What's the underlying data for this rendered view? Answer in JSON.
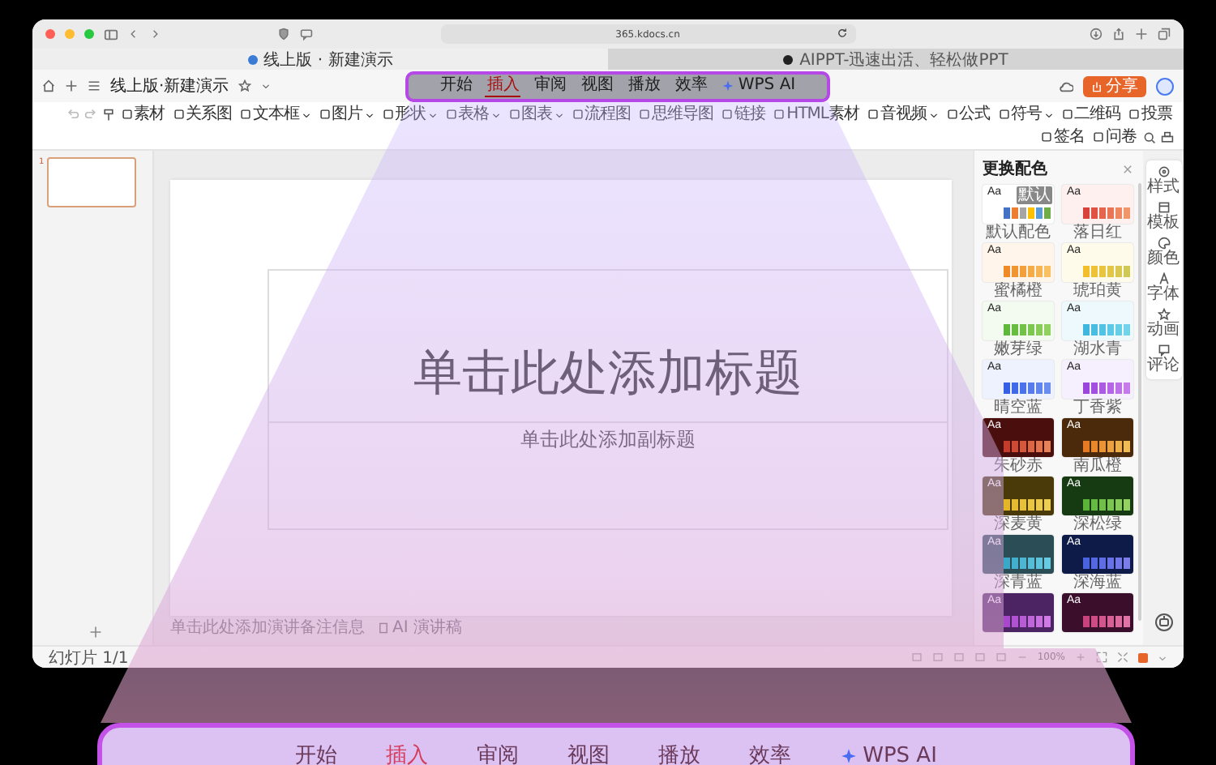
{
  "browser": {
    "url": "365.kdocs.cn",
    "tabs": [
      {
        "title": "线上版 · 新建演示",
        "selected": true
      },
      {
        "title": "AIPPT-迅速出活、轻松做PPT",
        "selected": false
      }
    ]
  },
  "app": {
    "doc_title": "线上版·新建演示",
    "tabs": [
      {
        "label": "开始",
        "selected": false
      },
      {
        "label": "插入",
        "selected": true
      },
      {
        "label": "审阅",
        "selected": false
      },
      {
        "label": "视图",
        "selected": false
      },
      {
        "label": "播放",
        "selected": false
      },
      {
        "label": "效率",
        "selected": false
      },
      {
        "label": "WPS AI",
        "selected": false
      }
    ],
    "share_label": "分享"
  },
  "toolbar": {
    "items": [
      {
        "label": "素材",
        "dropdown": false
      },
      {
        "label": "关系图",
        "dropdown": false
      },
      {
        "label": "文本框",
        "dropdown": true
      },
      {
        "label": "图片",
        "dropdown": true
      },
      {
        "label": "形状",
        "dropdown": true
      },
      {
        "label": "表格",
        "dropdown": true
      },
      {
        "label": "图表",
        "dropdown": true
      },
      {
        "label": "流程图",
        "dropdown": false
      },
      {
        "label": "思维导图",
        "dropdown": false
      },
      {
        "label": "链接",
        "dropdown": false
      },
      {
        "label": "HTML素材",
        "dropdown": false
      },
      {
        "label": "音视频",
        "dropdown": true
      },
      {
        "label": "公式",
        "dropdown": false
      },
      {
        "label": "符号",
        "dropdown": true
      },
      {
        "label": "二维码",
        "dropdown": false
      },
      {
        "label": "投票",
        "dropdown": false
      },
      {
        "label": "签名",
        "dropdown": false
      },
      {
        "label": "问卷",
        "dropdown": false
      }
    ]
  },
  "thumbnails": [
    {
      "number": "1",
      "selected": true
    }
  ],
  "slide": {
    "title": "单击此处添加标题",
    "subtitle": "单击此处添加副标题",
    "notes": "单击此处添加演讲备注信息",
    "ai_notes": "AI 演讲稿"
  },
  "theme_panel": {
    "title": "更换配色",
    "themes": [
      {
        "name": "默认配色",
        "sample": "Aa",
        "badge": "默认",
        "dark": false,
        "color": "#ffffff",
        "swatches": [
          {
            "color": "#4472c4"
          },
          {
            "color": "#ed7d31"
          },
          {
            "color": "#a5a5a5"
          },
          {
            "color": "#ffc000"
          },
          {
            "color": "#5b9bd5"
          },
          {
            "color": "#70ad47"
          }
        ]
      },
      {
        "name": "落日红",
        "sample": "Aa",
        "dark": false,
        "color": "#fdf0ee",
        "swatches": [
          {
            "color": "#d9423a"
          },
          {
            "color": "#e05243"
          },
          {
            "color": "#e5644c"
          },
          {
            "color": "#ea7555"
          },
          {
            "color": "#ee8660"
          },
          {
            "color": "#f1966a"
          }
        ]
      },
      {
        "name": "蜜橘橙",
        "sample": "Aa",
        "dark": false,
        "color": "#fff5ea",
        "swatches": [
          {
            "color": "#ef8a26"
          },
          {
            "color": "#f19530"
          },
          {
            "color": "#f3a03a"
          },
          {
            "color": "#f5ab46"
          },
          {
            "color": "#f6b552"
          },
          {
            "color": "#f8c060"
          }
        ]
      },
      {
        "name": "琥珀黄",
        "sample": "Aa",
        "dark": false,
        "color": "#fffbea",
        "swatches": [
          {
            "color": "#f2be2c"
          },
          {
            "color": "#eec236"
          },
          {
            "color": "#e8c43f"
          },
          {
            "color": "#e1c647"
          },
          {
            "color": "#d9c74e"
          },
          {
            "color": "#d0c854"
          }
        ]
      },
      {
        "name": "嫩芽绿",
        "sample": "Aa",
        "dark": false,
        "color": "#f3faef",
        "swatches": [
          {
            "color": "#5fb83a"
          },
          {
            "color": "#68bd40"
          },
          {
            "color": "#72c247"
          },
          {
            "color": "#7cc74f"
          },
          {
            "color": "#86cc57"
          },
          {
            "color": "#90d160"
          }
        ]
      },
      {
        "name": "湖水青",
        "sample": "Aa",
        "dark": false,
        "color": "#edf9fd",
        "swatches": [
          {
            "color": "#3fb6dd"
          },
          {
            "color": "#48bde0"
          },
          {
            "color": "#52c3e3"
          },
          {
            "color": "#5cc9e6"
          },
          {
            "color": "#66cfe8"
          },
          {
            "color": "#71d4eb"
          }
        ]
      },
      {
        "name": "晴空蓝",
        "sample": "Aa",
        "dark": false,
        "color": "#eef2fe",
        "swatches": [
          {
            "color": "#3560e6"
          },
          {
            "color": "#3f69e8"
          },
          {
            "color": "#4a72ea"
          },
          {
            "color": "#557bec"
          },
          {
            "color": "#6084ee"
          },
          {
            "color": "#6b8df0"
          }
        ]
      },
      {
        "name": "丁香紫",
        "sample": "Aa",
        "dark": false,
        "color": "#f6effd",
        "swatches": [
          {
            "color": "#9a45dc"
          },
          {
            "color": "#a34fdf"
          },
          {
            "color": "#ac5ae2"
          },
          {
            "color": "#b565e5"
          },
          {
            "color": "#be70e8"
          },
          {
            "color": "#c77beb"
          }
        ]
      },
      {
        "name": "朱砂赤",
        "sample": "Aa",
        "dark": true,
        "color": "#4a0f0c",
        "swatches": [
          {
            "color": "#c63c2c"
          },
          {
            "color": "#cd4a34"
          },
          {
            "color": "#d4583d"
          },
          {
            "color": "#da6646"
          },
          {
            "color": "#e0744f"
          },
          {
            "color": "#e68259"
          }
        ]
      },
      {
        "name": "南瓜橙",
        "sample": "Aa",
        "dark": true,
        "color": "#4b2a0b",
        "swatches": [
          {
            "color": "#e57a22"
          },
          {
            "color": "#e8872c"
          },
          {
            "color": "#ea9436"
          },
          {
            "color": "#eca140"
          },
          {
            "color": "#eeae4a"
          },
          {
            "color": "#f0bb55"
          }
        ]
      },
      {
        "name": "深麦黄",
        "sample": "Aa",
        "dark": true,
        "color": "#4a3a0a",
        "swatches": [
          {
            "color": "#e2b628"
          },
          {
            "color": "#e4bb31"
          },
          {
            "color": "#e6c03a"
          },
          {
            "color": "#e8c543"
          },
          {
            "color": "#eac94c"
          },
          {
            "color": "#ecce55"
          }
        ]
      },
      {
        "name": "深松绿",
        "sample": "Aa",
        "dark": true,
        "color": "#163b12",
        "swatches": [
          {
            "color": "#5bb33a"
          },
          {
            "color": "#66b942"
          },
          {
            "color": "#71bf4a"
          },
          {
            "color": "#7cc552"
          },
          {
            "color": "#87cb5a"
          },
          {
            "color": "#92d162"
          }
        ]
      },
      {
        "name": "深青蓝",
        "sample": "Aa",
        "dark": true,
        "color": "#2b4d55",
        "swatches": [
          {
            "color": "#3aa8c8"
          },
          {
            "color": "#43afce"
          },
          {
            "color": "#4cb6d3"
          },
          {
            "color": "#55bdd8"
          },
          {
            "color": "#5ec4dd"
          },
          {
            "color": "#67cbe2"
          }
        ]
      },
      {
        "name": "深海蓝",
        "sample": "Aa",
        "dark": true,
        "color": "#0e1a48",
        "swatches": [
          {
            "color": "#4a63e0"
          },
          {
            "color": "#5468e2"
          },
          {
            "color": "#5e6de4"
          },
          {
            "color": "#6872e6"
          },
          {
            "color": "#7277e8"
          },
          {
            "color": "#7c7cea"
          }
        ]
      },
      {
        "sample": "Aa",
        "dark": true,
        "color": "#4d2463",
        "swatches": [
          {
            "color": "#a848cc"
          },
          {
            "color": "#b052d1"
          },
          {
            "color": "#b85cd6"
          },
          {
            "color": "#c066db"
          },
          {
            "color": "#c870e0"
          },
          {
            "color": "#d07ae5"
          }
        ]
      },
      {
        "sample": "Aa",
        "dark": true,
        "color": "#3b0f2c",
        "swatches": [
          {
            "color": "#c8427e"
          },
          {
            "color": "#cd4c86"
          },
          {
            "color": "#d2568e"
          },
          {
            "color": "#d76096"
          },
          {
            "color": "#dc6a9e"
          },
          {
            "color": "#e174a6"
          }
        ]
      }
    ]
  },
  "side_rail": [
    {
      "label": "样式",
      "kind": "style"
    },
    {
      "label": "模板",
      "kind": "template"
    },
    {
      "label": "颜色",
      "kind": "color"
    },
    {
      "label": "字体",
      "kind": "font"
    },
    {
      "label": "动画",
      "kind": "animation"
    },
    {
      "label": "评论",
      "kind": "comment"
    }
  ],
  "status_bar": {
    "slide_count": "幻灯片 1/1",
    "zoom": "100%"
  },
  "callout": {
    "tabs": [
      {
        "label": "开始",
        "selected": false
      },
      {
        "label": "插入",
        "selected": true
      },
      {
        "label": "审阅",
        "selected": false
      },
      {
        "label": "视图",
        "selected": false
      },
      {
        "label": "播放",
        "selected": false
      },
      {
        "label": "效率",
        "selected": false
      },
      {
        "label": "WPS AI",
        "selected": false
      }
    ]
  }
}
